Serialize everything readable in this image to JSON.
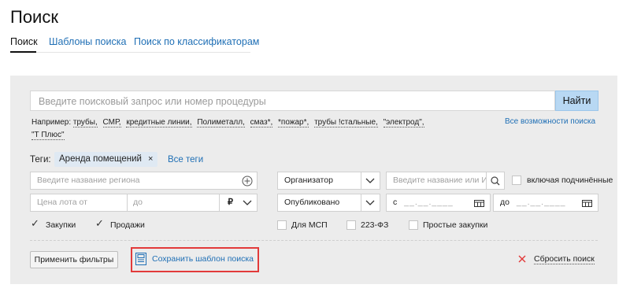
{
  "page_title": "Поиск",
  "tabs": [
    {
      "label": "Поиск"
    },
    {
      "label": "Шаблоны поиска"
    },
    {
      "label": "Поиск по классификаторам"
    }
  ],
  "search": {
    "placeholder": "Введите поисковый запрос или номер процедуры",
    "button_label": "Найти",
    "examples_label": "Например:",
    "examples": [
      "трубы,",
      "СМР,",
      "кредитные линии,",
      "Полиметалл,",
      "смаз*,",
      "*пожар*,",
      "трубы !стальные,",
      "\"электрод\",",
      "\"Т Плюс\""
    ],
    "all_options_link": "Все возможности поиска"
  },
  "tags": {
    "label": "Теги:",
    "active_tag": "Аренда помещений",
    "remove_symbol": "×",
    "all_tags_link": "Все теги"
  },
  "filters": {
    "region_placeholder": "Введите название региона",
    "organizer_select": "Организатор",
    "organizer_input_placeholder": "Введите название или ИНН",
    "include_subordinates": "включая подчинённые",
    "price_from_placeholder": "Цена лота от",
    "price_to_placeholder": "до",
    "currency_symbol": "₽",
    "status_select": "Опубликовано",
    "date_from_prefix": "с",
    "date_to_prefix": "до",
    "date_mask": "__.__.____",
    "checkboxes": [
      {
        "label": "Закупки",
        "checked": true
      },
      {
        "label": "Продажи",
        "checked": true
      },
      {
        "label": "Для МСП",
        "checked": false
      },
      {
        "label": "223-ФЗ",
        "checked": false
      },
      {
        "label": "Простые закупки",
        "checked": false
      }
    ]
  },
  "actions": {
    "apply_label": "Применить фильтры",
    "save_template_label": "Сохранить шаблон поиска",
    "reset_label": "Сбросить поиск"
  },
  "colors": {
    "link": "#1f6fb5",
    "button_primary": "#b8d8f3",
    "panel_bg": "#ececec",
    "highlight": "#e23a3a",
    "reset_icon": "#e23a3a"
  }
}
